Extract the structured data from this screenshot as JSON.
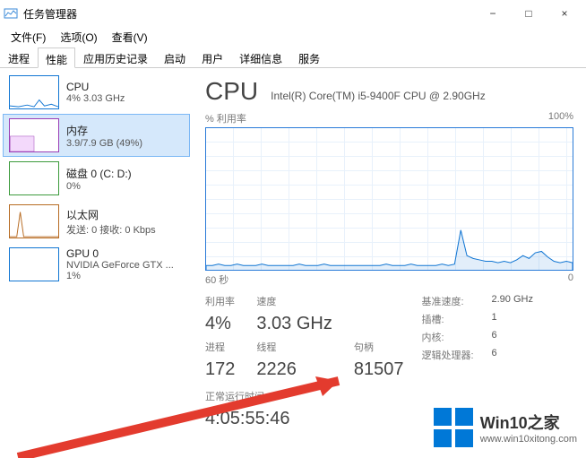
{
  "window": {
    "title": "任务管理器",
    "min_icon": "−",
    "max_icon": "□",
    "close_icon": "×"
  },
  "menu": {
    "file": "文件(F)",
    "options": "选项(O)",
    "view": "查看(V)"
  },
  "tabs": {
    "processes": "进程",
    "performance": "性能",
    "app_history": "应用历史记录",
    "startup": "启动",
    "users": "用户",
    "details": "详细信息",
    "services": "服务"
  },
  "sidebar": [
    {
      "name": "CPU",
      "detail": "4% 3.03 GHz"
    },
    {
      "name": "内存",
      "detail": "3.9/7.9 GB (49%)"
    },
    {
      "name": "磁盘 0 (C: D:)",
      "detail": "0%"
    },
    {
      "name": "以太网",
      "detail": "发送: 0 接收: 0 Kbps"
    },
    {
      "name": "GPU 0",
      "detail": "NVIDIA GeForce GTX ...",
      "extra": "1%"
    }
  ],
  "cpu": {
    "title": "CPU",
    "model": "Intel(R) Core(TM) i5-9400F CPU @ 2.90GHz",
    "chart_top_left": "% 利用率",
    "chart_top_right": "100%",
    "chart_bottom_left": "60 秒",
    "chart_bottom_right": "0",
    "util_label": "利用率",
    "util_value": "4%",
    "speed_label": "速度",
    "speed_value": "3.03 GHz",
    "proc_label": "进程",
    "proc_value": "172",
    "thread_label": "线程",
    "thread_value": "2226",
    "handle_label": "句柄",
    "handle_value": "81507",
    "uptime_label": "正常运行时间",
    "uptime_value": "4:05:55:46",
    "base_speed_label": "基准速度:",
    "base_speed_value": "2.90 GHz",
    "sockets_label": "插槽:",
    "sockets_value": "1",
    "cores_label": "内核:",
    "cores_value": "6",
    "logical_label": "逻辑处理器:",
    "logical_value": "6"
  },
  "watermark": {
    "brand": "Win10之家",
    "url": "www.win10xitong.com"
  },
  "chart_data": {
    "type": "line",
    "title": "% 利用率",
    "xlabel": "60 秒",
    "ylabel": "% 利用率",
    "ylim": [
      0,
      100
    ],
    "x_span_seconds": 60,
    "values": [
      3,
      3,
      4,
      3,
      3,
      4,
      3,
      3,
      3,
      4,
      3,
      3,
      3,
      3,
      3,
      4,
      3,
      3,
      3,
      4,
      3,
      3,
      3,
      3,
      3,
      3,
      3,
      3,
      3,
      4,
      3,
      3,
      3,
      4,
      3,
      3,
      3,
      3,
      4,
      3,
      4,
      28,
      10,
      8,
      7,
      6,
      6,
      5,
      6,
      5,
      7,
      10,
      8,
      12,
      13,
      9,
      6,
      5,
      6,
      5
    ]
  }
}
